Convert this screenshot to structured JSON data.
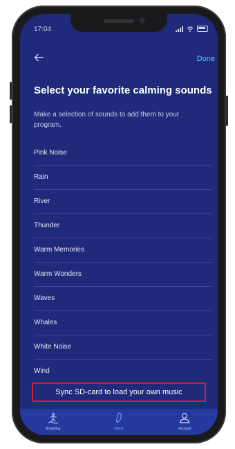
{
  "status": {
    "time": "17:04"
  },
  "header": {
    "back_icon": "arrow-left-icon",
    "done_label": "Done"
  },
  "page": {
    "title": "Select your favorite calming sounds",
    "subtitle": "Make a selection of sounds to add them to your program."
  },
  "sounds": [
    "Pink Noise",
    "Rain",
    "River",
    "Thunder",
    "Warm Memories",
    "Warm Wonders",
    "Waves",
    "Whales",
    "White Noise",
    "Wind"
  ],
  "sync": {
    "label": "Sync SD-card to load your own music"
  },
  "tabs": [
    {
      "label": "Breathing",
      "icon": "breathing-icon"
    },
    {
      "label": "Home",
      "icon": "home-icon"
    },
    {
      "label": "Account",
      "icon": "account-icon"
    }
  ],
  "colors": {
    "screen_bg": "#1f2a7a",
    "tab_bar_bg": "#253a9e",
    "accent": "#59c7ff",
    "highlight_border": "#d51f2f"
  }
}
